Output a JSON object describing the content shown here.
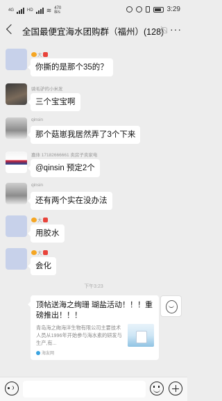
{
  "status_bar": {
    "network_a": "4G",
    "network_b": "HD",
    "speed": "470 B/s",
    "battery": "",
    "time": "3:29"
  },
  "header": {
    "title": "全国最便宜海水团购群（福州）(128)"
  },
  "messages": [
    {
      "id": "m1",
      "sender": "大",
      "text": "你撕的是那个35的？"
    },
    {
      "id": "m2",
      "sender": "骑毛驴的小米发",
      "text": "三个宝宝啊"
    },
    {
      "id": "m3",
      "sender": "qinsin",
      "text": "那个菇崽我居然弄了3个下来"
    },
    {
      "id": "m4",
      "sender": "嘉体 17182666661 卖房子卖家电",
      "text": "@qinsin  预定2个"
    },
    {
      "id": "m5",
      "sender": "qinsin",
      "text": "还有两个实在没办法"
    },
    {
      "id": "m6",
      "sender": "大",
      "text": "用胶水"
    },
    {
      "id": "m7",
      "sender": "大",
      "text": "会化"
    }
  ],
  "timestamp": "下午3:23",
  "share_card": {
    "title": "顶帖送海之绚珊 瑚盐活动！！！重磅推出！！！",
    "description": "青岛海之绚海洋生物有限公司主要技术人员从1996年开始参与海水素的研发与生产,有...",
    "source": "海友网"
  },
  "icons": {
    "back": "back-arrow-icon",
    "mute": "mute-bell-icon",
    "more": "more-dots-icon",
    "voice": "voice-input-icon",
    "emoji": "emoji-icon",
    "plus": "plus-icon"
  }
}
